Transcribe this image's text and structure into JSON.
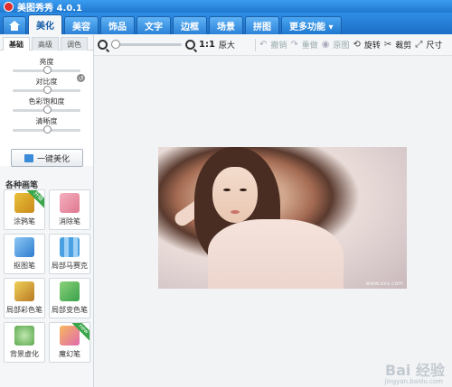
{
  "app": {
    "title": "美图秀秀 4.0.1"
  },
  "tabs": [
    {
      "label": "美化"
    },
    {
      "label": "美容"
    },
    {
      "label": "饰品"
    },
    {
      "label": "文字"
    },
    {
      "label": "边框"
    },
    {
      "label": "场景"
    },
    {
      "label": "拼图"
    },
    {
      "label": "更多功能 ▾"
    }
  ],
  "toolbar": {
    "ratio_label": "1:1",
    "original_label": "原大",
    "undo_label": "撤销",
    "redo_label": "重做",
    "original_img_label": "原图",
    "rotate_label": "旋转",
    "crop_label": "裁剪",
    "resize_label": "尺寸"
  },
  "panel": {
    "subtabs": [
      {
        "label": "基础"
      },
      {
        "label": "高级"
      },
      {
        "label": "调色"
      }
    ],
    "adjust": [
      {
        "label": "亮度",
        "value": 0.5
      },
      {
        "label": "对比度",
        "value": 0.5
      },
      {
        "label": "色彩饱和度",
        "value": 0.5
      },
      {
        "label": "清晰度",
        "value": 0.5
      }
    ],
    "oneclick_label": "一键美化",
    "brush_title": "各种画笔",
    "brushes": [
      {
        "label": "涂鸦笔",
        "icon": "pencil-icon",
        "badge": "升级"
      },
      {
        "label": "消除笔",
        "icon": "eraser-icon"
      },
      {
        "label": "抠图笔",
        "icon": "cutout-icon"
      },
      {
        "label": "局部马赛克",
        "icon": "mosaic-icon"
      },
      {
        "label": "局部彩色笔",
        "icon": "color-brush-icon"
      },
      {
        "label": "局部变色笔",
        "icon": "recolor-icon"
      },
      {
        "label": "背景虚化",
        "icon": "blur-icon"
      },
      {
        "label": "魔幻笔",
        "icon": "magic-wand-icon",
        "badge": "new"
      }
    ]
  },
  "watermark": {
    "brand": "Bai 经验",
    "sub": "jingyan.baidu.com"
  },
  "photo_caption": "www.xxx.com"
}
